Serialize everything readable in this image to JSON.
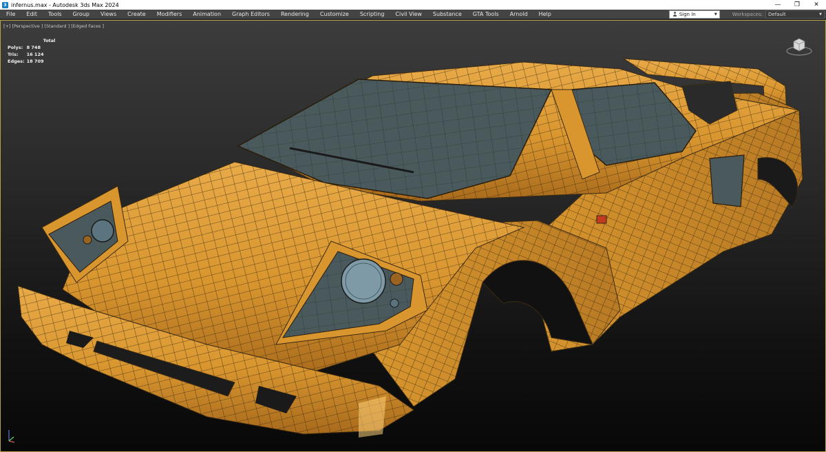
{
  "window": {
    "title": "infernus.max - Autodesk 3ds Max 2024",
    "minimize_glyph": "—",
    "restore_glyph": "❐",
    "close_glyph": "✕"
  },
  "menu": {
    "items": [
      "File",
      "Edit",
      "Tools",
      "Group",
      "Views",
      "Create",
      "Modifiers",
      "Animation",
      "Graph Editors",
      "Rendering",
      "Customize",
      "Scripting",
      "Civil View",
      "Substance",
      "GTA Tools",
      "Arnold",
      "Help"
    ]
  },
  "account": {
    "sign_in_label": "Sign In",
    "workspaces_label": "Workspaces:",
    "workspace_value": "Default"
  },
  "viewport": {
    "label": "[+] [Perspective ] [Standard ] [Edged Faces ]",
    "stats": {
      "header": "Total",
      "rows": [
        {
          "label": "Polys:",
          "value": "8 748"
        },
        {
          "label": "Tris:",
          "value": "16 124"
        },
        {
          "label": "Edges:",
          "value": "18 709"
        }
      ]
    },
    "viewcube_icon": "viewcube-icon",
    "axis_icon": "axis-tripod-icon"
  },
  "colors": {
    "car_body": "#e0a040",
    "car_shadow": "#9a6420",
    "wire": "#3b2a12",
    "glass": "#4a5a5c",
    "viewport_border": "#b9a34a"
  }
}
